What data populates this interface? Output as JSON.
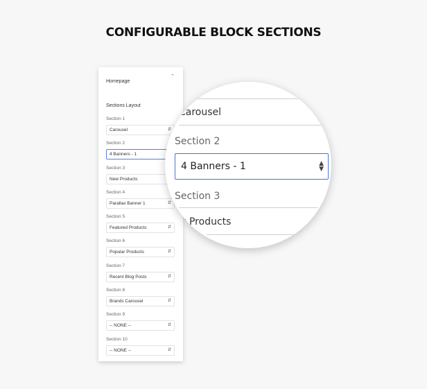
{
  "title": "CONFIGURABLE BLOCK SECTIONS",
  "panel": {
    "header": "Homepage",
    "header_icon": "chevron-up-icon",
    "layout_label": "Sections Layout",
    "sections": [
      {
        "label": "Section 1",
        "value": "Carousel"
      },
      {
        "label": "Section 2",
        "value": "4 Banners - 1",
        "active": true
      },
      {
        "label": "Section 3",
        "value": "New Products"
      },
      {
        "label": "Section 4",
        "value": "Parallax Banner 1"
      },
      {
        "label": "Section 5",
        "value": "Featured Products"
      },
      {
        "label": "Section 6",
        "value": "Popular Products"
      },
      {
        "label": "Section 7",
        "value": "Recent Blog Posts"
      },
      {
        "label": "Section 8",
        "value": "Brands Carousel"
      },
      {
        "label": "Section 9",
        "value": "-- NONE --"
      },
      {
        "label": "Section 10",
        "value": "-- NONE --"
      }
    ]
  },
  "magnifier": {
    "prev_value": "Carousel",
    "label": "Section 2",
    "value": "4 Banners - 1",
    "next_label": "Section 3",
    "next_value": "New Products",
    "accent_color": "#4a72d8"
  }
}
